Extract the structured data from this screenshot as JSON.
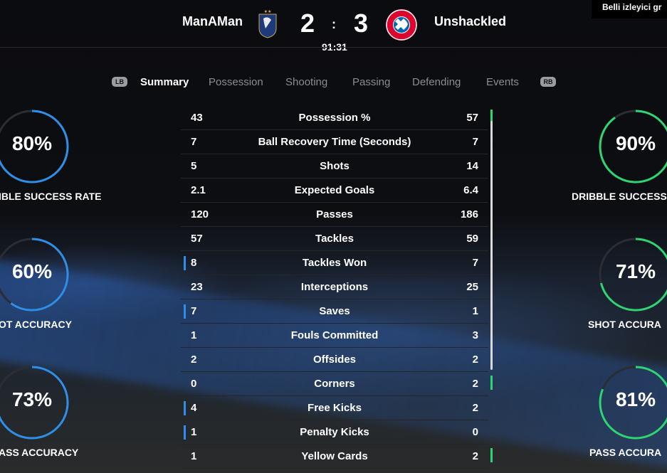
{
  "notification": {
    "text": "Belli izleyici gr"
  },
  "match": {
    "home": {
      "name": "ManAMan",
      "score": "2",
      "crest_icon": "france-crest-icon"
    },
    "away": {
      "name": "Unshackled",
      "score": "3",
      "crest_icon": "bayern-crest-icon"
    },
    "separator": ":",
    "clock": "91:31"
  },
  "tabs": {
    "left_bumper": "LB",
    "right_bumper": "RB",
    "items": [
      "Summary",
      "Possession",
      "Shooting",
      "Passing",
      "Defending",
      "Events"
    ],
    "active": "Summary"
  },
  "colors": {
    "home_accent": "#2f8fe8",
    "away_accent": "#2ed573",
    "ring_track": "#2b2d33"
  },
  "stats": [
    {
      "label": "Possession %",
      "home": "43",
      "away": "57",
      "leader": "away"
    },
    {
      "label": "Ball Recovery Time (Seconds)",
      "home": "7",
      "away": "7",
      "leader": "none"
    },
    {
      "label": "Shots",
      "home": "5",
      "away": "14",
      "leader": "away"
    },
    {
      "label": "Expected Goals",
      "home": "2.1",
      "away": "6.4",
      "leader": "away"
    },
    {
      "label": "Passes",
      "home": "120",
      "away": "186",
      "leader": "away"
    },
    {
      "label": "Tackles",
      "home": "57",
      "away": "59",
      "leader": "away"
    },
    {
      "label": "Tackles Won",
      "home": "8",
      "away": "7",
      "leader": "home"
    },
    {
      "label": "Interceptions",
      "home": "23",
      "away": "25",
      "leader": "away"
    },
    {
      "label": "Saves",
      "home": "7",
      "away": "1",
      "leader": "home"
    },
    {
      "label": "Fouls Committed",
      "home": "1",
      "away": "3",
      "leader": "away"
    },
    {
      "label": "Offsides",
      "home": "2",
      "away": "2",
      "leader": "none"
    },
    {
      "label": "Corners",
      "home": "0",
      "away": "2",
      "leader": "away"
    },
    {
      "label": "Free Kicks",
      "home": "4",
      "away": "2",
      "leader": "home"
    },
    {
      "label": "Penalty Kicks",
      "home": "1",
      "away": "0",
      "leader": "home"
    },
    {
      "label": "Yellow Cards",
      "home": "1",
      "away": "2",
      "leader": "away"
    }
  ],
  "rings": {
    "home": [
      {
        "label": "IBLE SUCCESS RATE",
        "value_label": "80%",
        "fraction": 0.8
      },
      {
        "label": "OT ACCURACY",
        "value_label": "60%",
        "fraction": 0.6
      },
      {
        "label": "ASS ACCURACY",
        "value_label": "73%",
        "fraction": 0.73
      }
    ],
    "away": [
      {
        "label": "DRIBBLE SUCCESS",
        "value_label": "90%",
        "fraction": 0.9
      },
      {
        "label": "SHOT ACCURA",
        "value_label": "71%",
        "fraction": 0.71
      },
      {
        "label": "PASS ACCURA",
        "value_label": "81%",
        "fraction": 0.81
      }
    ]
  }
}
